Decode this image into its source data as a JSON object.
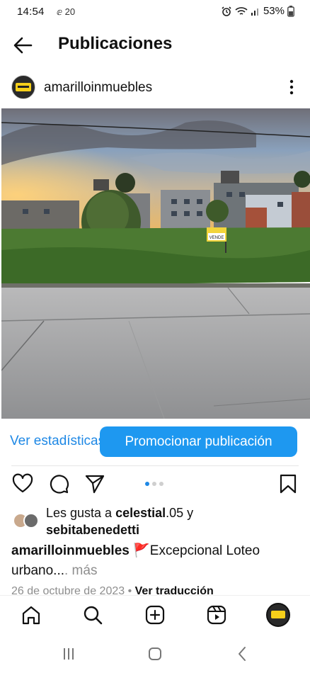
{
  "status_bar": {
    "time": "14:54",
    "left_icons": "ⅇ 20",
    "battery": "53%"
  },
  "header": {
    "title": "Publicaciones"
  },
  "post": {
    "username": "amarilloinmuebles",
    "photo_sign_text": "VENDE",
    "stats_label": "Ver estadísticas",
    "promote_label": "Promocionar publicación",
    "likes_prefix": "Les gusta a ",
    "liker_1": "celestial",
    "liker_1_tail": ".05 y",
    "liker_2": "sebitabenedetti",
    "caption_user": "amarilloinmuebles",
    "caption_text": " 🚩Excepcional Loteo urbano...",
    "caption_more": ". más",
    "date": "26 de octubre de 2023",
    "date_sep": " • ",
    "translate": "Ver traducción",
    "carousel_count": 3,
    "carousel_active": 1
  },
  "icons": {
    "back": "arrow-left-icon",
    "more": "more-vertical-icon",
    "like": "heart-icon",
    "comment": "comment-icon",
    "share": "send-icon",
    "save": "bookmark-icon",
    "home": "home-icon",
    "search": "search-icon",
    "create": "plus-square-icon",
    "reels": "reels-icon",
    "profile": "profile-avatar"
  },
  "colors": {
    "accent": "#1e98f0",
    "link": "#1e88e5",
    "muted": "#8e8e8e"
  }
}
